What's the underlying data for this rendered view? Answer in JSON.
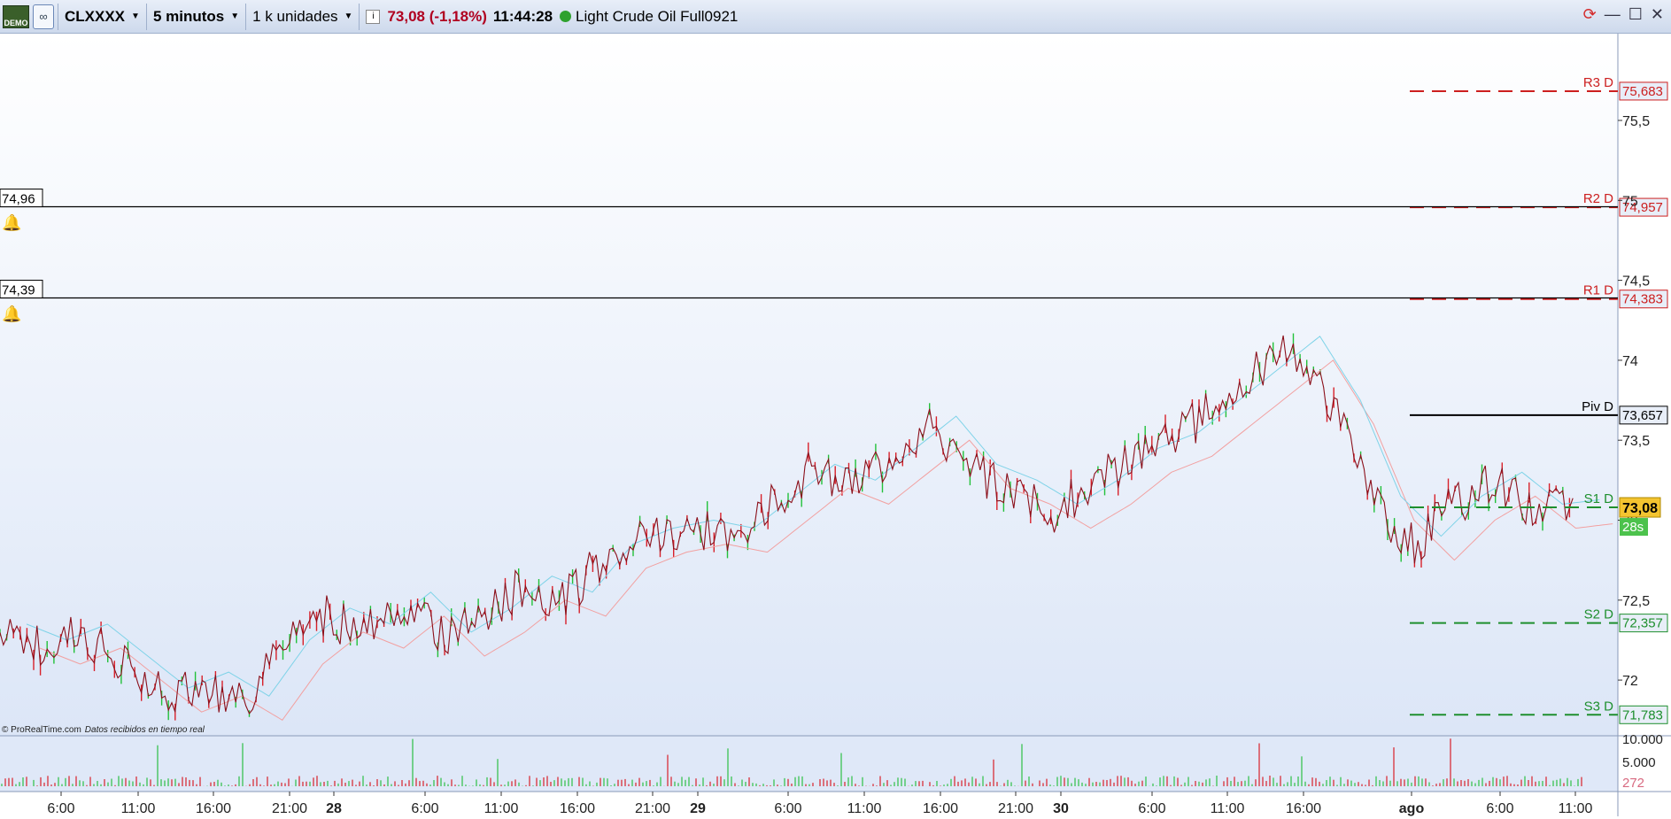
{
  "toolbar": {
    "demo_label": "DEMO",
    "symbol": "CLXXXX",
    "timeframe": "5 minutos",
    "units": "1 k unidades",
    "price_change": "73,08 (-1,18%)",
    "clock": "11:44:28",
    "instrument": "Light Crude Oil Full0921"
  },
  "chart": {
    "watermark": "© ProRealTime.com",
    "watermark_note": "Datos recibidos en tiempo real",
    "countdown": "28s",
    "alerts": [
      {
        "price": "74,96",
        "level": 74.96
      },
      {
        "price": "74,39",
        "level": 74.39
      }
    ],
    "pivots": [
      {
        "label": "R3 D",
        "value": "75,683",
        "level": 75.683,
        "color": "#cc1f1f",
        "dashed": true
      },
      {
        "label": "R2 D",
        "value": "74,957",
        "level": 74.957,
        "color": "#cc1f1f",
        "dashed": true
      },
      {
        "label": "R1 D",
        "value": "74,383",
        "level": 74.383,
        "color": "#cc1f1f",
        "dashed": true
      },
      {
        "label": "Piv D",
        "value": "73,657",
        "level": 73.657,
        "color": "#000000",
        "dashed": false
      },
      {
        "label": "S1 D",
        "value": "",
        "level": 73.08,
        "color": "#1e8f2e",
        "dashed": true
      },
      {
        "label": "S2 D",
        "value": "72,357",
        "level": 72.357,
        "color": "#1e8f2e",
        "dashed": true
      },
      {
        "label": "S3 D",
        "value": "71,783",
        "level": 71.783,
        "color": "#1e8f2e",
        "dashed": true
      }
    ],
    "current_price": {
      "value": "73,08",
      "level": 73.08
    },
    "y_ticks": [
      {
        "label": "75,5",
        "level": 75.5
      },
      {
        "label": "75",
        "level": 75.0
      },
      {
        "label": "74,5",
        "level": 74.5
      },
      {
        "label": "74",
        "level": 74.0
      },
      {
        "label": "73,5",
        "level": 73.5
      },
      {
        "label": "73",
        "level": 73.0
      },
      {
        "label": "72,5",
        "level": 72.5
      },
      {
        "label": "72",
        "level": 72.0
      }
    ],
    "volume_ticks": [
      "10.000",
      "5.000",
      "272"
    ],
    "x_ticks": [
      {
        "label": "6:00",
        "bold": false
      },
      {
        "label": "11:00",
        "bold": false
      },
      {
        "label": "16:00",
        "bold": false
      },
      {
        "label": "21:00",
        "bold": false
      },
      {
        "label": "28",
        "bold": true
      },
      {
        "label": "6:00",
        "bold": false
      },
      {
        "label": "11:00",
        "bold": false
      },
      {
        "label": "16:00",
        "bold": false
      },
      {
        "label": "21:00",
        "bold": false
      },
      {
        "label": "29",
        "bold": true
      },
      {
        "label": "6:00",
        "bold": false
      },
      {
        "label": "11:00",
        "bold": false
      },
      {
        "label": "16:00",
        "bold": false
      },
      {
        "label": "21:00",
        "bold": false
      },
      {
        "label": "30",
        "bold": true
      },
      {
        "label": "6:00",
        "bold": false
      },
      {
        "label": "11:00",
        "bold": false
      },
      {
        "label": "16:00",
        "bold": false
      },
      {
        "label": "ago",
        "bold": true
      },
      {
        "label": "6:00",
        "bold": false
      },
      {
        "label": "11:00",
        "bold": false
      }
    ],
    "series_path": [
      72.3,
      72.2,
      72.3,
      72.1,
      71.9,
      72.0,
      71.85,
      72.2,
      72.4,
      72.3,
      72.5,
      72.25,
      72.4,
      72.6,
      72.5,
      72.8,
      72.9,
      72.95,
      72.9,
      73.1,
      73.3,
      73.2,
      73.4,
      73.6,
      73.3,
      73.2,
      73.05,
      73.2,
      73.4,
      73.5,
      73.7,
      73.9,
      74.1,
      73.7,
      73.1,
      72.85,
      73.1,
      73.25,
      73.05,
      73.08
    ]
  }
}
